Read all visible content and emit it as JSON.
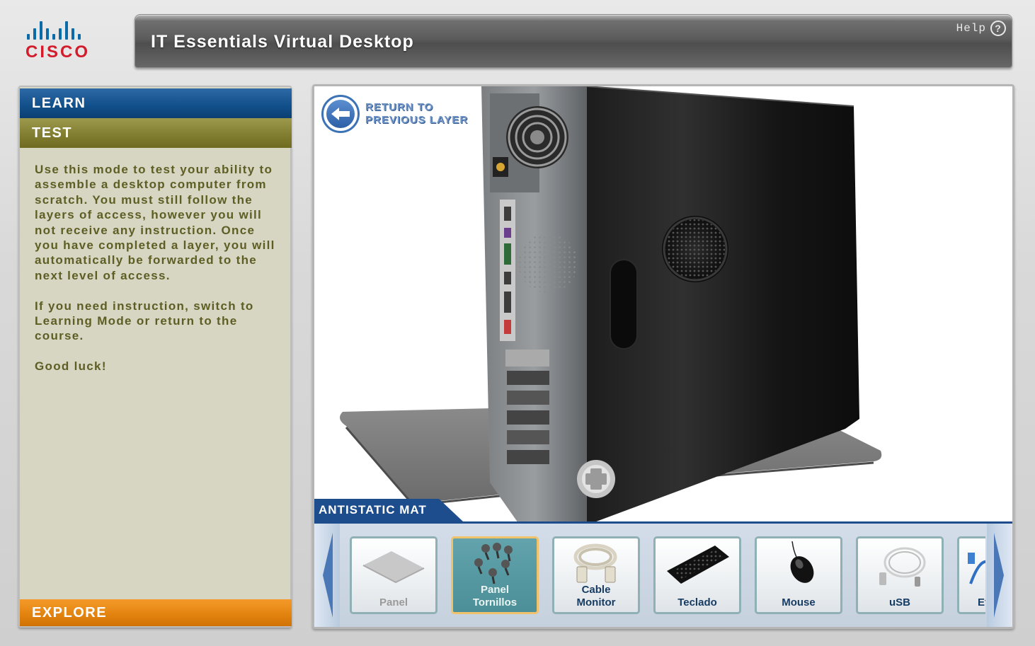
{
  "brand": {
    "name": "cisco",
    "logo_color": "#0b6aa8",
    "wordmark_color": "#d31b2b"
  },
  "header": {
    "title": "IT Essentials Virtual Desktop",
    "help_label": "Help",
    "help_icon": "question-circle-icon"
  },
  "modes": {
    "learn": {
      "label": "LEARN",
      "color": "#114f8a"
    },
    "test": {
      "label": "TEST",
      "color": "#7f7c2f"
    },
    "explore": {
      "label": "EXPLORE",
      "color": "#e2820e"
    }
  },
  "instructions": [
    "Use this mode to test your ability to assemble a desktop computer from scratch. You must still follow the layers of access, however you will not receive any instruction. Once you have completed a layer, you will automatically be forwarded to the next level of access.",
    "If you need instruction, switch to Learning Mode or return to the course.",
    "Good luck!"
  ],
  "main": {
    "return_button": {
      "line1": "RETURN TO",
      "line2": "PREVIOUS LAYER",
      "icon": "arrow-left-icon"
    },
    "layer_label": "ANTISTATIC MAT"
  },
  "tray": {
    "items": [
      {
        "label": "Panel",
        "icon": "panel-icon",
        "state": "disabled"
      },
      {
        "label": "Panel\nTornillos",
        "icon": "screws-icon",
        "state": "selected"
      },
      {
        "label": "Cable\nMonitor",
        "icon": "vga-cable-icon",
        "state": "normal"
      },
      {
        "label": "Teclado",
        "icon": "keyboard-icon",
        "state": "normal"
      },
      {
        "label": "Mouse",
        "icon": "mouse-icon",
        "state": "normal"
      },
      {
        "label": "uSB",
        "icon": "usb-cable-icon",
        "state": "normal"
      },
      {
        "label": "Et",
        "icon": "ethernet-cable-icon",
        "state": "normal"
      }
    ]
  }
}
